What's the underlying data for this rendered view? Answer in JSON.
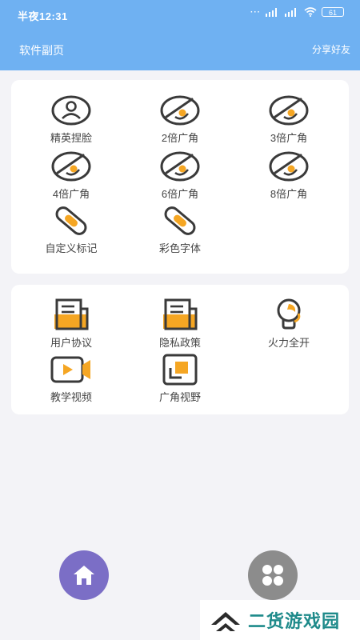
{
  "status_bar": {
    "time": "半夜12:31",
    "dots": "···",
    "battery": "61"
  },
  "header": {
    "title": "软件副页",
    "share": "分享好友"
  },
  "tools": [
    {
      "label": "精英捏脸",
      "icon": "face-icon"
    },
    {
      "label": "2倍广角",
      "icon": "lens-icon"
    },
    {
      "label": "3倍广角",
      "icon": "lens-icon"
    },
    {
      "label": "4倍广角",
      "icon": "lens-icon"
    },
    {
      "label": "6倍广角",
      "icon": "lens-icon"
    },
    {
      "label": "8倍广角",
      "icon": "lens-icon"
    },
    {
      "label": "自定义标记",
      "icon": "link-icon"
    },
    {
      "label": "彩色字体",
      "icon": "link-icon"
    }
  ],
  "more": [
    {
      "label": "用户协议",
      "icon": "document-icon"
    },
    {
      "label": "隐私政策",
      "icon": "document-icon"
    },
    {
      "label": "火力全开",
      "icon": "bulb-icon"
    },
    {
      "label": "教学视频",
      "icon": "video-icon"
    },
    {
      "label": "广角视野",
      "icon": "crop-icon"
    }
  ],
  "watermark": {
    "text": "二货游戏园"
  },
  "colors": {
    "header": "#6fb1f2",
    "accent": "#f5a623",
    "icon_stroke": "#3a3a3a",
    "home_fab": "#7b6ec6",
    "menu_fab": "#8c8c8c"
  }
}
